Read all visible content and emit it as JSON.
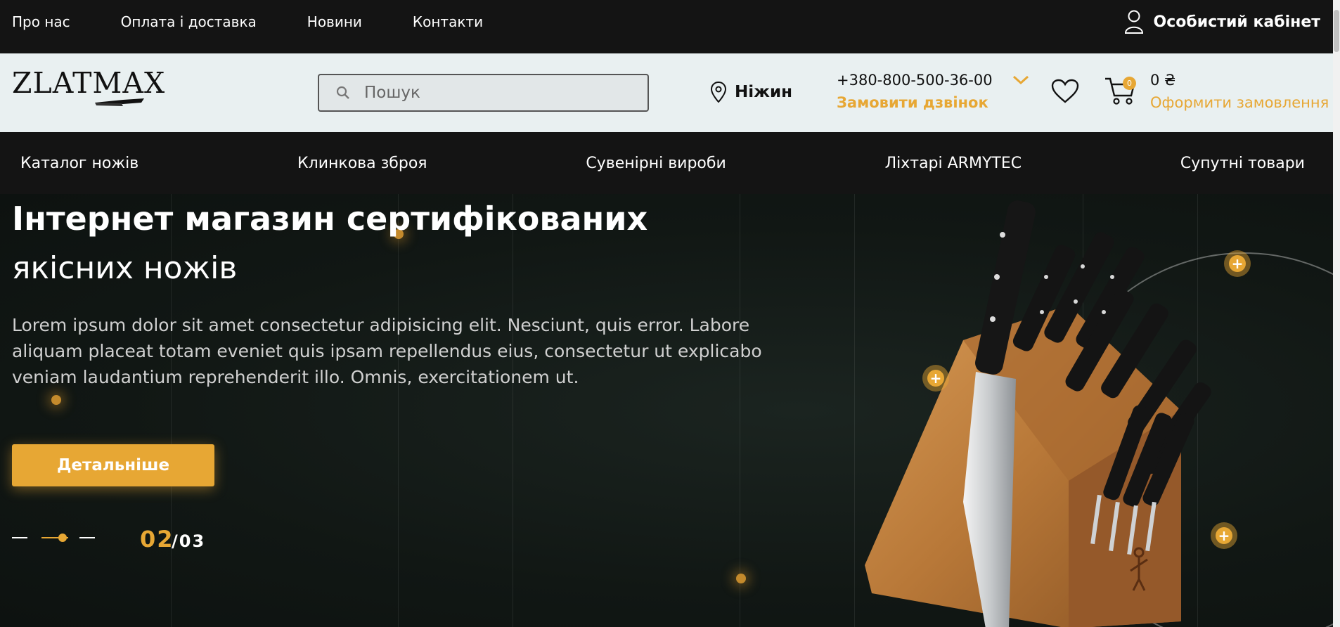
{
  "topbar": {
    "links": [
      "Про нас",
      "Оплата і доставка",
      "Новини",
      "Контакти"
    ],
    "account_label": "Особистий кабінет"
  },
  "header": {
    "logo_text": "ZLATMAX",
    "search_placeholder": "Пошук",
    "city": "Ніжин",
    "phone": "+380-800-500-36-00",
    "callback_label": "Замовити дзвінок",
    "cart_count": "0",
    "cart_sum": "0 ₴",
    "order_label": "Оформити замовлення"
  },
  "nav": {
    "items": [
      "Каталог ножів",
      "Клинкова зброя",
      "Сувенірні вироби",
      "Ліхтарі ARMYTEC",
      "Супутні товари"
    ]
  },
  "hero": {
    "title_line1": "Інтернет магазин сертифікованих",
    "title_line2": "якісних ножів",
    "description": "Lorem ipsum dolor sit amet consectetur adipisicing elit. Nesciunt, quis error. Labore aliquam placeat totam eveniet quis ipsam repellendus eius, consectetur ut explicabo veniam laudantium reprehenderit illo. Omnis, exercitationem ut.",
    "button_label": "Детальніше",
    "slide_current": "02",
    "slide_total": "/03"
  },
  "colors": {
    "accent": "#e7a734",
    "dark": "#141414",
    "header_bg": "#e9f0f1"
  }
}
